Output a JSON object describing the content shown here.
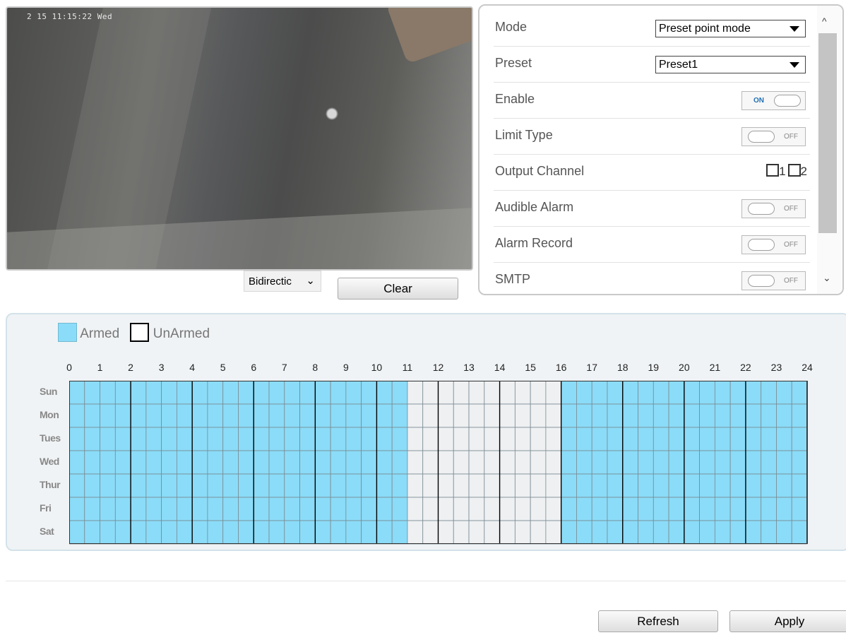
{
  "video": {
    "osd_text": "2 15 11:15:22 Wed"
  },
  "controls": {
    "direction": "Bidirectic",
    "clear_label": "Clear"
  },
  "settings": {
    "mode": {
      "label": "Mode",
      "value": "Preset point mode"
    },
    "preset": {
      "label": "Preset",
      "value": "Preset1"
    },
    "enable": {
      "label": "Enable",
      "state": "ON"
    },
    "limit_type": {
      "label": "Limit Type",
      "state": "OFF"
    },
    "output_channel": {
      "label": "Output Channel",
      "options": [
        "1",
        "2"
      ]
    },
    "audible_alarm": {
      "label": "Audible Alarm",
      "state": "OFF"
    },
    "alarm_record": {
      "label": "Alarm Record",
      "state": "OFF"
    },
    "smtp": {
      "label": "SMTP",
      "state": "OFF"
    }
  },
  "schedule": {
    "legend": {
      "armed": "Armed",
      "unarmed": "UnArmed"
    },
    "hours": [
      "0",
      "1",
      "2",
      "3",
      "4",
      "5",
      "6",
      "7",
      "8",
      "9",
      "10",
      "11",
      "12",
      "13",
      "14",
      "15",
      "16",
      "17",
      "18",
      "19",
      "20",
      "21",
      "22",
      "23",
      "24"
    ],
    "days": [
      "Sun",
      "Mon",
      "Tues",
      "Wed",
      "Thur",
      "Fri",
      "Sat"
    ],
    "armed_half_hours": "all except 11:00-16:00",
    "colors": {
      "armed": "#8bdcf8",
      "unarmed": "#eef0f2"
    }
  },
  "footer": {
    "refresh_label": "Refresh",
    "apply_label": "Apply"
  }
}
